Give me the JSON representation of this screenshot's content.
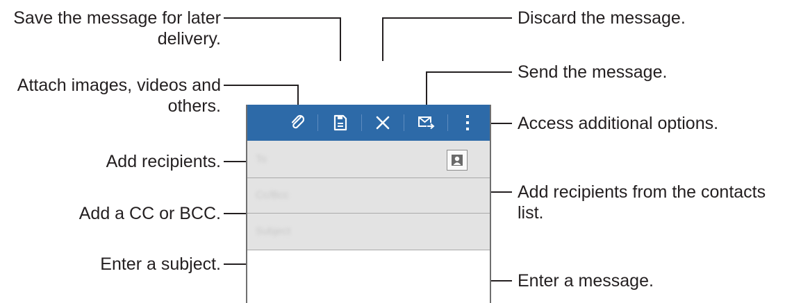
{
  "callouts": {
    "save_line1": "Save the message for later",
    "save_line2": "delivery.",
    "attach_line1": "Attach images, videos and",
    "attach_line2": "others.",
    "add_recipients": "Add recipients.",
    "add_cc_bcc": "Add a CC or BCC.",
    "enter_subject": "Enter a subject.",
    "discard": "Discard the message.",
    "send": "Send the message.",
    "more_options": "Access additional options.",
    "contacts_line1": "Add recipients from the contacts",
    "contacts_line2": "list.",
    "enter_message": "Enter a message."
  },
  "compose": {
    "to_hint": "To",
    "cc_bcc_hint": "Cc/Bcc",
    "subject_hint": "Subject"
  },
  "toolbar_icons": [
    "attach-icon",
    "save-icon",
    "discard-icon",
    "send-icon",
    "more-options-icon"
  ],
  "colors": {
    "action_bar": "#2d6aa8",
    "field_bg": "#e3e3e3",
    "text": "#231f20"
  }
}
